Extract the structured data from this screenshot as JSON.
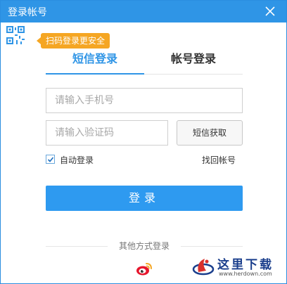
{
  "window": {
    "title": "登录帐号"
  },
  "qr": {
    "badge": "扫码登录更安全"
  },
  "tabs": [
    {
      "label": "短信登录",
      "active": true
    },
    {
      "label": "帐号登录",
      "active": false
    }
  ],
  "form": {
    "phone_placeholder": "请输入手机号",
    "code_placeholder": "请输入验证码",
    "sms_button": "短信获取",
    "auto_login_label": "自动登录",
    "auto_login_checked": true,
    "forgot_link": "找回帐号",
    "login_button": "登录"
  },
  "other": {
    "label": "其他方式登录",
    "providers": [
      "weibo-icon"
    ]
  },
  "watermark": {
    "brand": "这里下载",
    "url": "www.herdown.com"
  },
  "colors": {
    "primary": "#2f95e6",
    "badge": "#f5a623",
    "weibo": "#e6162d"
  }
}
